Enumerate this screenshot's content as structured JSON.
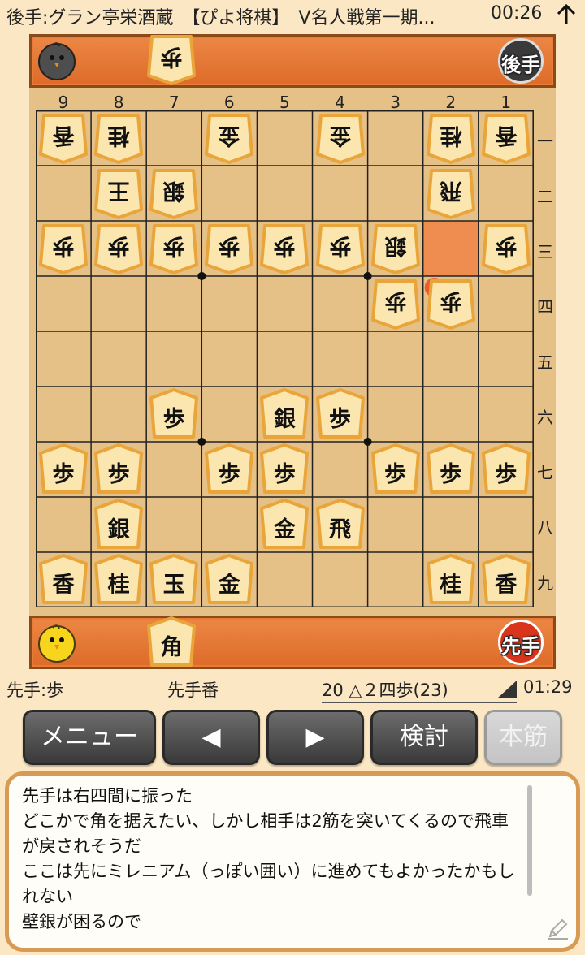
{
  "header": {
    "title": "後手:グラン亭栄酒蔵　【ぴよ将棋】　V名人戦第一期...",
    "time": "00:26"
  },
  "gote_stand": {
    "pieces": [
      "歩"
    ],
    "badge": "後手"
  },
  "sente_stand": {
    "pieces": [
      "角"
    ],
    "badge": "先手"
  },
  "board": {
    "file_labels": [
      "9",
      "8",
      "7",
      "6",
      "5",
      "4",
      "3",
      "2",
      "1"
    ],
    "rank_labels": [
      "一",
      "二",
      "三",
      "四",
      "五",
      "六",
      "七",
      "八",
      "九"
    ],
    "pieces": [
      {
        "label": "香",
        "owner": "gote",
        "file": 9,
        "rank": 1
      },
      {
        "label": "桂",
        "owner": "gote",
        "file": 8,
        "rank": 1
      },
      {
        "label": "金",
        "owner": "gote",
        "file": 6,
        "rank": 1
      },
      {
        "label": "金",
        "owner": "gote",
        "file": 4,
        "rank": 1
      },
      {
        "label": "桂",
        "owner": "gote",
        "file": 2,
        "rank": 1
      },
      {
        "label": "香",
        "owner": "gote",
        "file": 1,
        "rank": 1
      },
      {
        "label": "王",
        "owner": "gote",
        "file": 8,
        "rank": 2
      },
      {
        "label": "銀",
        "owner": "gote",
        "file": 7,
        "rank": 2
      },
      {
        "label": "飛",
        "owner": "gote",
        "file": 2,
        "rank": 2
      },
      {
        "label": "歩",
        "owner": "gote",
        "file": 9,
        "rank": 3
      },
      {
        "label": "歩",
        "owner": "gote",
        "file": 8,
        "rank": 3
      },
      {
        "label": "歩",
        "owner": "gote",
        "file": 7,
        "rank": 3
      },
      {
        "label": "歩",
        "owner": "gote",
        "file": 6,
        "rank": 3
      },
      {
        "label": "歩",
        "owner": "gote",
        "file": 5,
        "rank": 3
      },
      {
        "label": "歩",
        "owner": "gote",
        "file": 4,
        "rank": 3
      },
      {
        "label": "銀",
        "owner": "gote",
        "file": 3,
        "rank": 3
      },
      {
        "label": "歩",
        "owner": "gote",
        "file": 1,
        "rank": 3
      },
      {
        "label": "歩",
        "owner": "gote",
        "file": 3,
        "rank": 4
      },
      {
        "label": "歩",
        "owner": "gote",
        "file": 2,
        "rank": 4
      },
      {
        "label": "歩",
        "owner": "sente",
        "file": 7,
        "rank": 6
      },
      {
        "label": "銀",
        "owner": "sente",
        "file": 5,
        "rank": 6
      },
      {
        "label": "歩",
        "owner": "sente",
        "file": 4,
        "rank": 6
      },
      {
        "label": "歩",
        "owner": "sente",
        "file": 9,
        "rank": 7
      },
      {
        "label": "歩",
        "owner": "sente",
        "file": 8,
        "rank": 7
      },
      {
        "label": "歩",
        "owner": "sente",
        "file": 6,
        "rank": 7
      },
      {
        "label": "歩",
        "owner": "sente",
        "file": 5,
        "rank": 7
      },
      {
        "label": "歩",
        "owner": "sente",
        "file": 3,
        "rank": 7
      },
      {
        "label": "歩",
        "owner": "sente",
        "file": 2,
        "rank": 7
      },
      {
        "label": "歩",
        "owner": "sente",
        "file": 1,
        "rank": 7
      },
      {
        "label": "銀",
        "owner": "sente",
        "file": 8,
        "rank": 8
      },
      {
        "label": "金",
        "owner": "sente",
        "file": 5,
        "rank": 8
      },
      {
        "label": "飛",
        "owner": "sente",
        "file": 4,
        "rank": 8
      },
      {
        "label": "香",
        "owner": "sente",
        "file": 9,
        "rank": 9
      },
      {
        "label": "桂",
        "owner": "sente",
        "file": 8,
        "rank": 9
      },
      {
        "label": "玉",
        "owner": "sente",
        "file": 7,
        "rank": 9
      },
      {
        "label": "金",
        "owner": "sente",
        "file": 6,
        "rank": 9
      },
      {
        "label": "桂",
        "owner": "sente",
        "file": 2,
        "rank": 9
      },
      {
        "label": "香",
        "owner": "sente",
        "file": 1,
        "rank": 9
      }
    ],
    "last_move_from": {
      "file": 2,
      "rank": 3
    }
  },
  "status": {
    "hand": "先手:歩",
    "turn": "先手番",
    "move": "20 △２四歩(23)",
    "time": "01:29"
  },
  "buttons": {
    "menu": "メニュー",
    "back": "◀",
    "forward": "▶",
    "study": "検討",
    "mainline": "本筋"
  },
  "comment": "先手は右四間に振った\nどこかで角を据えたい、しかし相手は2筋を突いてくるので飛車が戻されそうだ\nここは先にミレニアム（っぽい囲い）に進めてもよかったかもしれない\n壁銀が困るので",
  "colors": {
    "background": "#fce7c4",
    "stand": "#e87b36",
    "board": "#e6c187",
    "last_move": "#ef8d50",
    "marker": "#f05a2a"
  }
}
